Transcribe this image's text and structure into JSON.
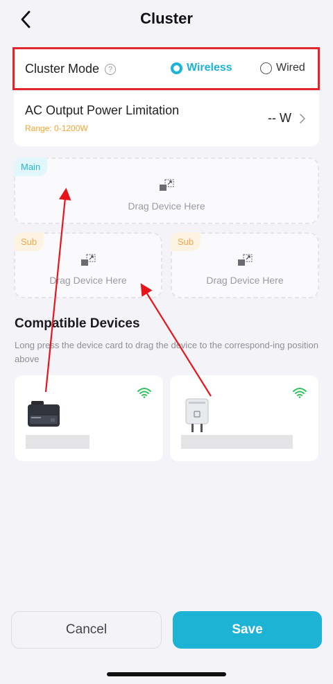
{
  "header": {
    "title": "Cluster"
  },
  "cluster_mode": {
    "label": "Cluster Mode",
    "help_glyph": "?",
    "options": [
      {
        "label": "Wireless",
        "selected": true
      },
      {
        "label": "Wired",
        "selected": false
      }
    ]
  },
  "ac_output": {
    "title": "AC Output Power Limitation",
    "range": "Range: 0-1200W",
    "value": "-- W"
  },
  "drop_zones": {
    "main": {
      "tag": "Main",
      "text": "Drag Device Here"
    },
    "sub1": {
      "tag": "Sub",
      "text": "Drag Device Here"
    },
    "sub2": {
      "tag": "Sub",
      "text": "Drag Device Here"
    }
  },
  "compatible": {
    "title": "Compatible Devices",
    "description": "Long press the device card to drag the device to the correspond-ing position above",
    "devices": [
      {
        "icon": "power-station-icon",
        "status_icon": "wifi-icon"
      },
      {
        "icon": "smart-plug-icon",
        "status_icon": "wifi-icon"
      }
    ]
  },
  "footer": {
    "cancel": "Cancel",
    "save": "Save"
  },
  "colors": {
    "accent": "#1cb3d4",
    "highlight_box": "#e0262b",
    "range_text": "#f2a530",
    "wifi": "#2fc25b",
    "annotation_arrow": "#e8141b"
  }
}
